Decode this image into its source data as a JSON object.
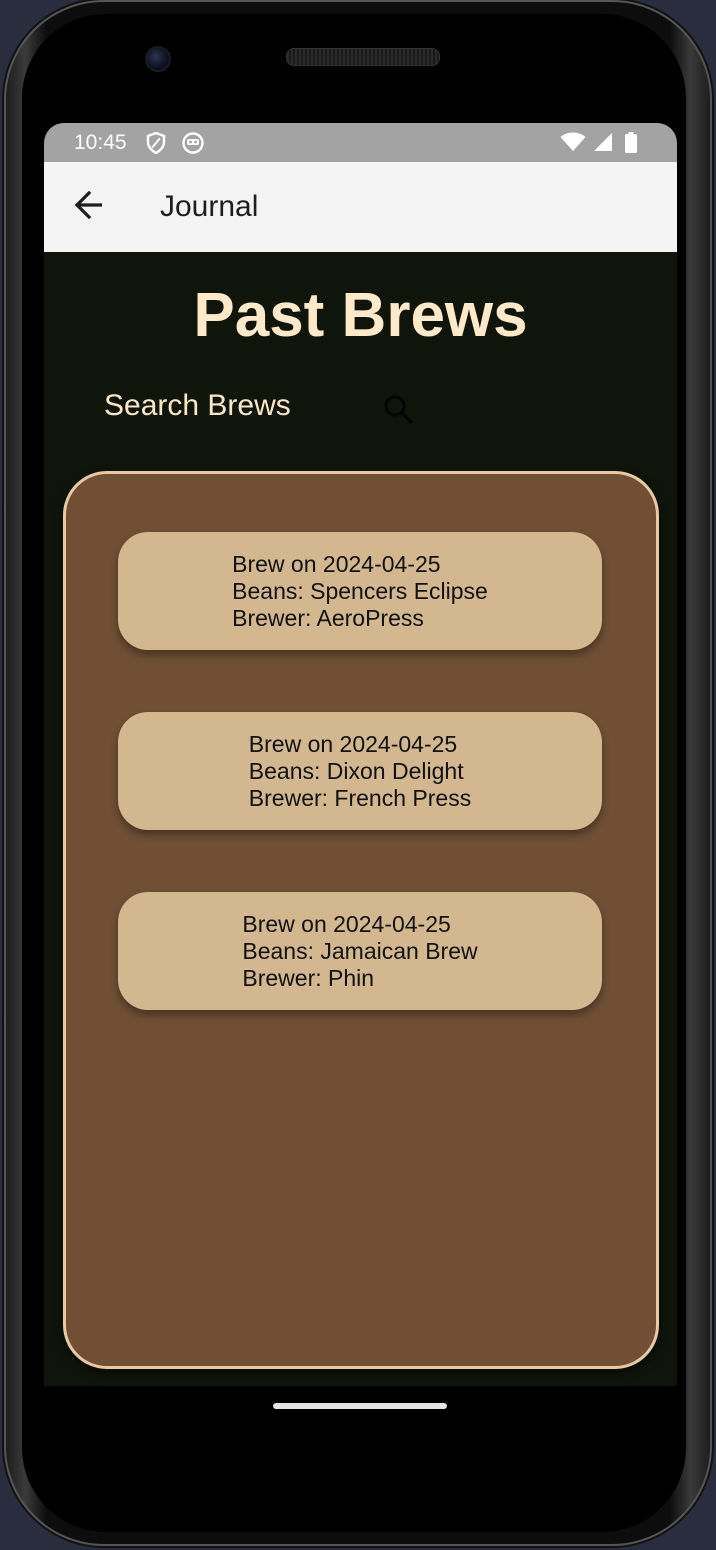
{
  "status_bar": {
    "time": "10:45",
    "left_icons": [
      "shield-icon",
      "robot-icon"
    ],
    "right_icons": [
      "wifi-icon",
      "signal-icon",
      "battery-icon"
    ]
  },
  "app_bar": {
    "back_icon": "arrow-left-icon",
    "title": "Journal"
  },
  "page": {
    "title": "Past Brews"
  },
  "search": {
    "placeholder": "Search Brews",
    "icon": "search-icon"
  },
  "brews": [
    {
      "date_line": "Brew on 2024-04-25",
      "beans_line": "Beans: Spencers Eclipse",
      "brewer_line": "Brewer: AeroPress"
    },
    {
      "date_line": "Brew on 2024-04-25",
      "beans_line": "Beans: Dixon Delight",
      "brewer_line": "Brewer: French Press"
    },
    {
      "date_line": "Brew on 2024-04-25",
      "beans_line": "Beans: Jamaican Brew",
      "brewer_line": "Brewer: Phin"
    }
  ],
  "colors": {
    "background": "#10150b",
    "title": "#ffe9c9",
    "panel": "#704f34",
    "panel_border": "#e9c9a2",
    "card": "#d3b78f"
  }
}
